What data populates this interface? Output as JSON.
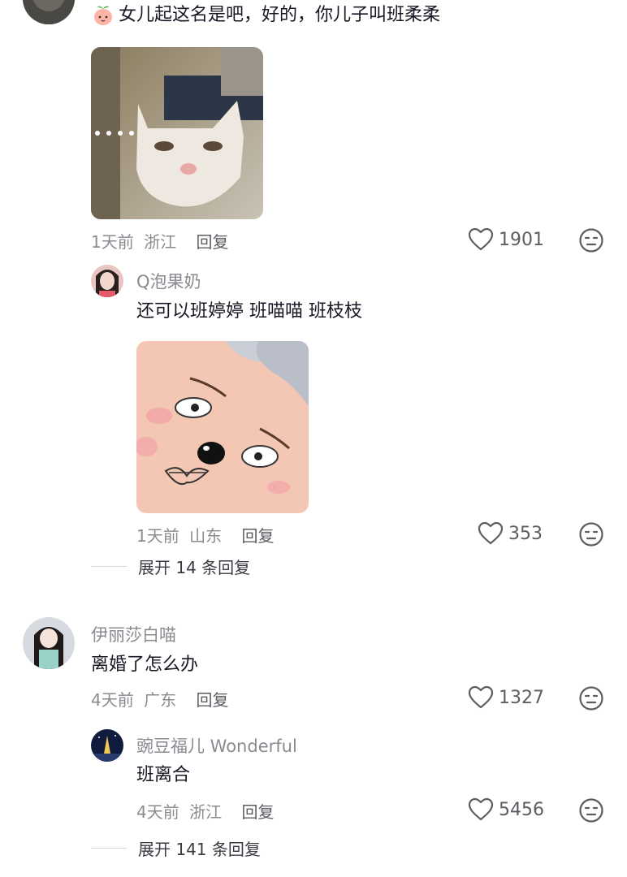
{
  "comment1": {
    "text": "女儿起这名是吧，好的，你儿子叫班柔柔",
    "time": "1天前",
    "location": "浙江",
    "reply_label": "回复",
    "likes": "1901",
    "replies": [
      {
        "username": "Q泡果奶",
        "text": "还可以班婷婷 班喵喵 班枝枝",
        "time": "1天前",
        "location": "山东",
        "reply_label": "回复",
        "likes": "353"
      }
    ],
    "expand_label": "展开 14 条回复"
  },
  "comment2": {
    "username": "伊丽莎白喵",
    "text": "离婚了怎么办",
    "time": "4天前",
    "location": "广东",
    "reply_label": "回复",
    "likes": "1327",
    "replies": [
      {
        "username": "豌豆福儿 Wonderful",
        "text": "班离合",
        "time": "4天前",
        "location": "浙江",
        "reply_label": "回复",
        "likes": "5456"
      }
    ],
    "expand_label": "展开 141 条回复"
  },
  "icons": {
    "like": "heart-outline-icon",
    "dislike": "neutral-face-icon",
    "badge": "peach-emoji-icon"
  },
  "colors": {
    "text": "#161823",
    "meta": "#8a8b91",
    "background": "#ffffff"
  }
}
